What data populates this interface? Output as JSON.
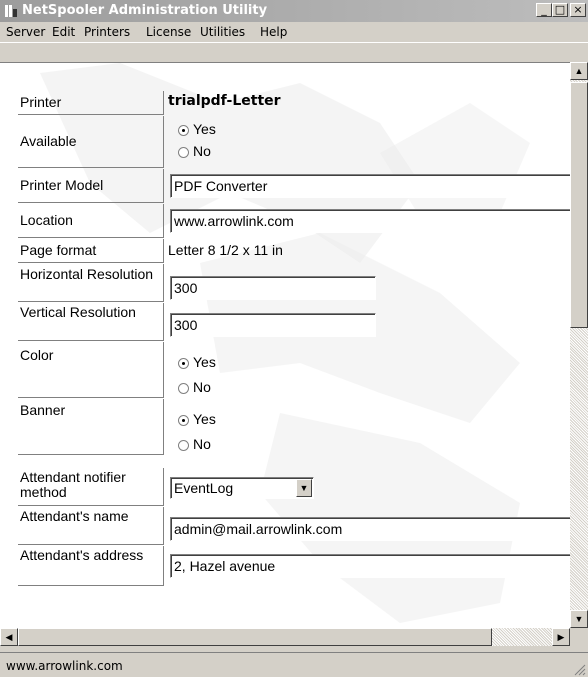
{
  "window": {
    "title": "NetSpooler Administration Utility",
    "controls": {
      "minimize": "_",
      "maximize": "□",
      "close": "×"
    }
  },
  "menu": [
    "Server",
    "Edit",
    "Printers",
    "License",
    "Utilities",
    "Help"
  ],
  "form": {
    "printer": {
      "label": "Printer",
      "value": "trialpdf-Letter"
    },
    "available": {
      "label": "Available",
      "options": [
        "Yes",
        "No"
      ],
      "selected": "Yes"
    },
    "printer_model": {
      "label": "Printer Model",
      "value": "PDF Converter"
    },
    "location": {
      "label": "Location",
      "value": "www.arrowlink.com"
    },
    "page_format": {
      "label": "Page format",
      "value": "Letter 8 1/2 x 11 in"
    },
    "horizontal_resolution": {
      "label": "Horizontal Resolution",
      "value": "300"
    },
    "vertical_resolution": {
      "label": "Vertical Resolution",
      "value": "300"
    },
    "color": {
      "label": "Color",
      "options": [
        "Yes",
        "No"
      ],
      "selected": "Yes"
    },
    "banner": {
      "label": "Banner",
      "options": [
        "Yes",
        "No"
      ],
      "selected": "Yes"
    },
    "attendant_notifier_method": {
      "label": "Attendant notifier method",
      "value": "EventLog"
    },
    "attendants_name": {
      "label": "Attendant's name",
      "value": "admin@mail.arrowlink.com"
    },
    "attendants_address": {
      "label": "Attendant's address",
      "value": "2, Hazel avenue"
    }
  },
  "status_bar": {
    "text": "www.arrowlink.com"
  },
  "colors": {
    "title_bar": "#a8a8a8",
    "chrome": "#d4d0c8",
    "content": "#ffffff"
  }
}
